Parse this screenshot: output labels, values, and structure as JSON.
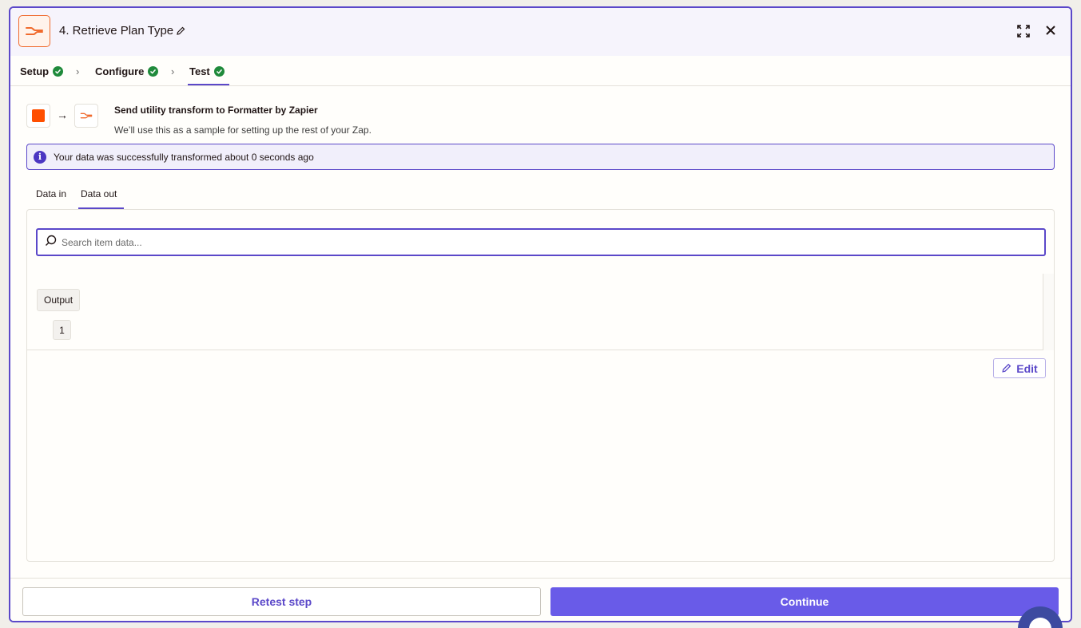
{
  "header": {
    "title": "4. Retrieve Plan Type",
    "icons": {
      "app": "formatter-icon",
      "edit": "pencil-icon",
      "expand": "expand-icon",
      "close": "close-icon"
    }
  },
  "steps": [
    {
      "label": "Setup",
      "status": "complete"
    },
    {
      "label": "Configure",
      "status": "complete"
    },
    {
      "label": "Test",
      "status": "complete",
      "active": true
    }
  ],
  "send": {
    "title": "Send utility transform to Formatter by Zapier",
    "subtitle": "We’ll use this as a sample for setting up the rest of your Zap."
  },
  "info_banner": {
    "text": "Your data was successfully transformed about 0 seconds ago"
  },
  "tabs": [
    {
      "label": "Data in",
      "active": false
    },
    {
      "label": "Data out",
      "active": true
    }
  ],
  "search": {
    "placeholder": "Search item data...",
    "value": ""
  },
  "tree": {
    "root_label": "Output",
    "index_label": "1"
  },
  "edit_label": "Edit",
  "footer": {
    "retest_label": "Retest step",
    "continue_label": "Continue"
  },
  "colors": {
    "accent": "#5b48c9",
    "brand_orange": "#ff4f00",
    "success": "#1f8a3b",
    "continue_bg": "#695be8"
  }
}
